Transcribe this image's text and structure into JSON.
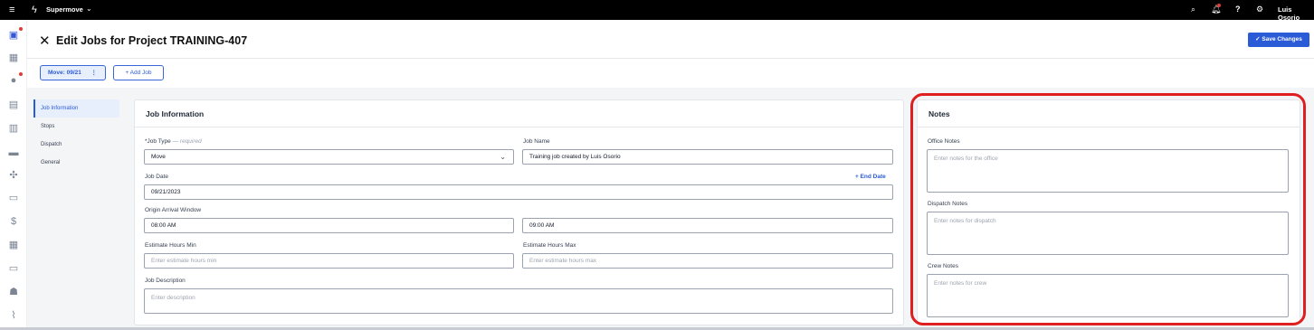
{
  "topbar": {
    "brand": "Supermove",
    "user": "Luis Osorio",
    "icons": [
      "menu-icon",
      "bolt-logo-icon",
      "search-icon",
      "bell-icon",
      "help-icon",
      "gear-icon"
    ]
  },
  "rail": {
    "icons": [
      "calendar-check-icon",
      "calendar-icon",
      "check-circle-icon",
      "clipboard-icon",
      "boxes-icon",
      "truck-icon",
      "people-move-icon",
      "crate-icon",
      "dollar-icon",
      "calculator-icon",
      "ticket-icon",
      "users-icon",
      "chart-icon"
    ]
  },
  "header": {
    "title": "Edit Jobs for Project TRAINING-407",
    "save_label": "✓ Save Changes"
  },
  "job_tabs": {
    "move_label": "Move: 09/21",
    "add_label": "+ Add Job"
  },
  "section_nav": [
    "Job Information",
    "Stops",
    "Dispatch",
    "General"
  ],
  "job_info": {
    "title": "Job Information",
    "job_type_label": "*Job Type",
    "job_type_required": "— required",
    "job_type_value": "Move",
    "job_name_label": "Job Name",
    "job_name_value": "Training job created by Luis Osorio",
    "job_date_label": "Job Date",
    "end_date_label": "+ End Date",
    "job_date_value": "09/21/2023",
    "arrival_label": "Origin Arrival Window",
    "arrival_start": "08:00 AM",
    "arrival_end": "09:00 AM",
    "est_min_label": "Estimate Hours Min",
    "est_min_placeholder": "Enter estimate hours min",
    "est_max_label": "Estimate Hours Max",
    "est_max_placeholder": "Enter estimate hours max",
    "desc_label": "Job Description",
    "desc_placeholder": "Enter description"
  },
  "notes": {
    "title": "Notes",
    "office_label": "Office Notes",
    "office_placeholder": "Enter notes for the office",
    "dispatch_label": "Dispatch Notes",
    "dispatch_placeholder": "Enter notes for dispatch",
    "crew_label": "Crew Notes",
    "crew_placeholder": "Enter notes for crew"
  },
  "colors": {
    "accent": "#2b5bd7",
    "highlight": "#e02020",
    "topbar": "#000000"
  }
}
